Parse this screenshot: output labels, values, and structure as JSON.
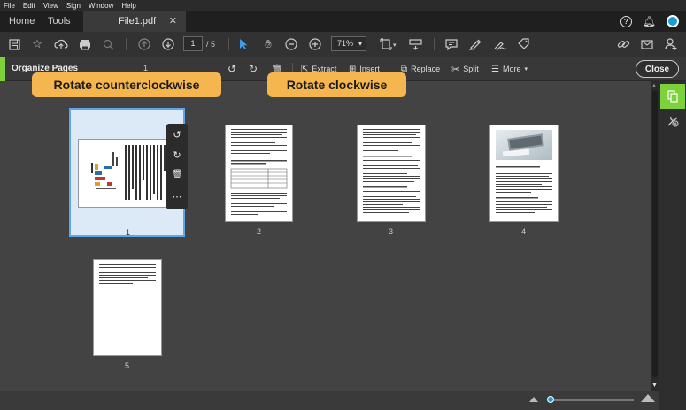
{
  "menu": [
    "File",
    "Edit",
    "View",
    "Sign",
    "Window",
    "Help"
  ],
  "tabs": {
    "home": "Home",
    "tools": "Tools",
    "file": "File1.pdf"
  },
  "toolbar": {
    "current_page": "1",
    "total_pages": "/ 5",
    "zoom": "71%"
  },
  "organize": {
    "title": "Organize Pages",
    "range_value": "1",
    "buttons": {
      "extract": "Extract",
      "insert": "Insert",
      "replace": "Replace",
      "split": "Split",
      "more": "More"
    },
    "close": "Close"
  },
  "callouts": {
    "ccw": "Rotate counterclockwise",
    "cw": "Rotate clockwise"
  },
  "pages": [
    {
      "number": "1",
      "selected": true
    },
    {
      "number": "2",
      "selected": false
    },
    {
      "number": "3",
      "selected": false
    },
    {
      "number": "4",
      "selected": false
    },
    {
      "number": "5",
      "selected": false
    }
  ],
  "zoom_slider_level": 0.02,
  "colors": {
    "accent_green": "#7dd13a",
    "callout": "#f6b64f",
    "selection": "#dce9f6",
    "blue": "#1e9bdb"
  }
}
